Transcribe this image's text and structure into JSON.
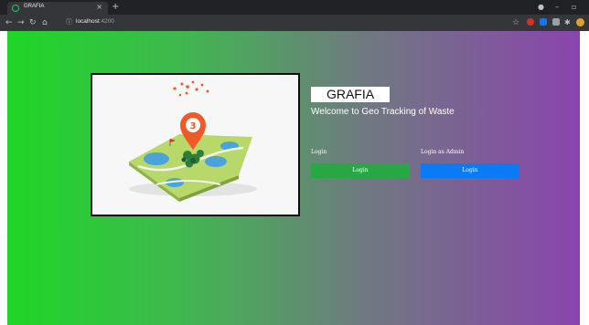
{
  "browser": {
    "tab_title": "GRAFIA",
    "tab_close": "×",
    "new_tab": "+",
    "url_host": "localhost",
    "url_port": ":4200",
    "icons": [
      "back-icon",
      "forward-icon",
      "reload-icon",
      "home-icon",
      "info-icon",
      "star-icon",
      "extension-icons",
      "profile-avatar"
    ]
  },
  "app": {
    "brand": "GRAFIA",
    "subtitle": "Welcome to Geo Tracking of Waste",
    "hero_badge": "3",
    "login": {
      "label": "Login",
      "button": "Login",
      "color": "#28a745"
    },
    "admin": {
      "label": "Login as Admin",
      "button": "Login",
      "color": "#0a7af5"
    },
    "background_gradient": [
      "#1ed626",
      "#8a44ad"
    ]
  }
}
